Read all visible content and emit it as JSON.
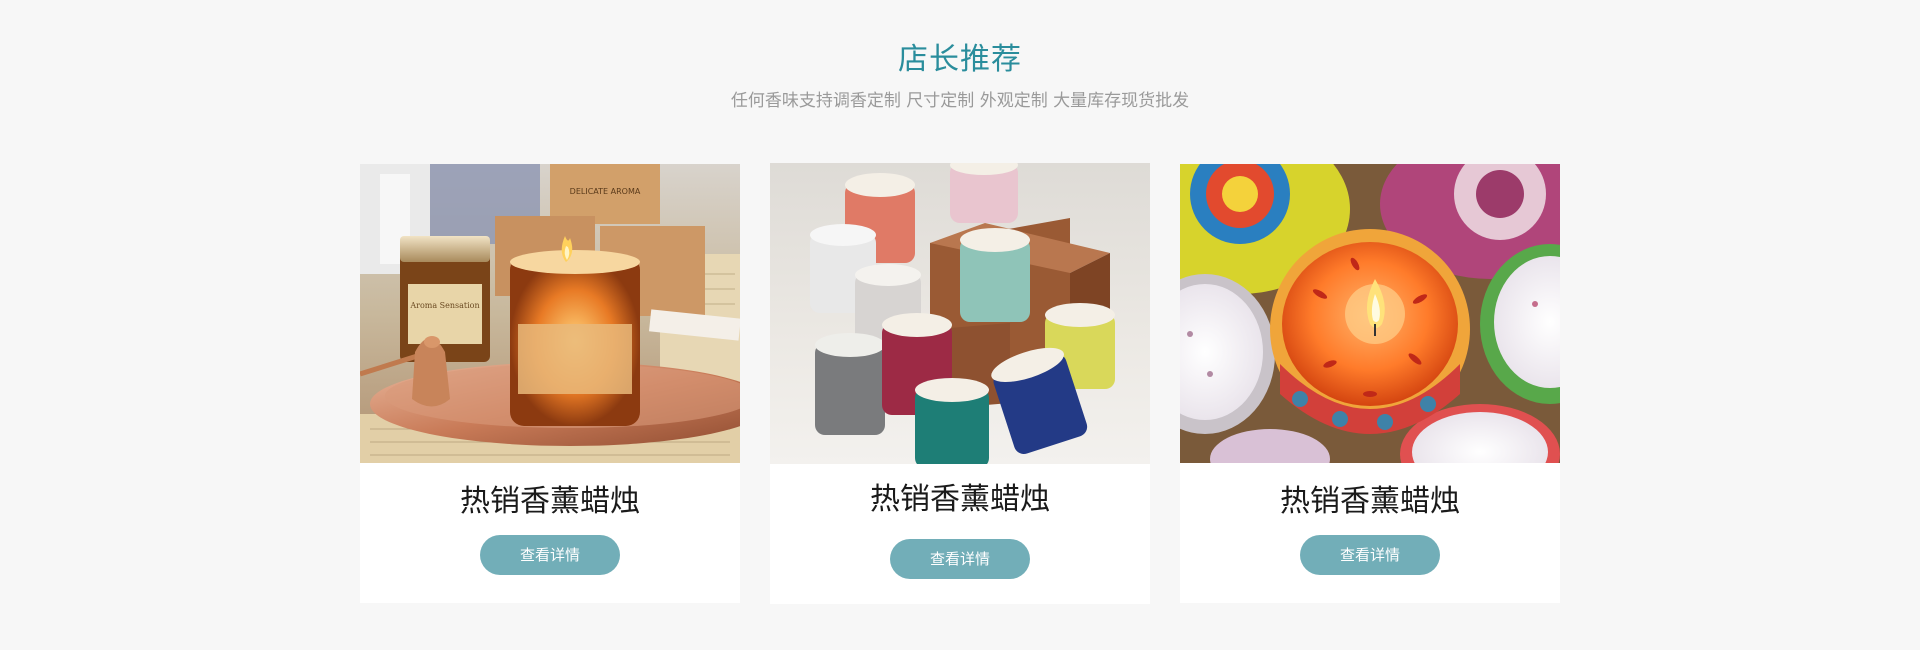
{
  "section": {
    "title": "店长推荐",
    "subtitle": "任何香味支持调香定制 尺寸定制 外观定制 大量库存现货批发"
  },
  "products": [
    {
      "title": "热销香薰蜡烛",
      "button_label": "查看详情",
      "image_subject": "amber glass jar candles with rose-gold tray and snuffer"
    },
    {
      "title": "热销香薰蜡烛",
      "button_label": "查看详情",
      "image_subject": "colorful textured concrete cup candles"
    },
    {
      "title": "热销香薰蜡烛",
      "button_label": "查看详情",
      "image_subject": "decorated travel tin candles with dried flowers"
    }
  ],
  "image_text": {
    "jar_label": "Aroma Sensation",
    "box_label": "DELICATE AROMA"
  },
  "colors": {
    "page_background": "#f7f7f7",
    "title": "#2a8d9c",
    "subtitle": "#9a9a9a",
    "card_background": "#ffffff",
    "button": "#72aeb8",
    "button_text": "#ffffff"
  }
}
